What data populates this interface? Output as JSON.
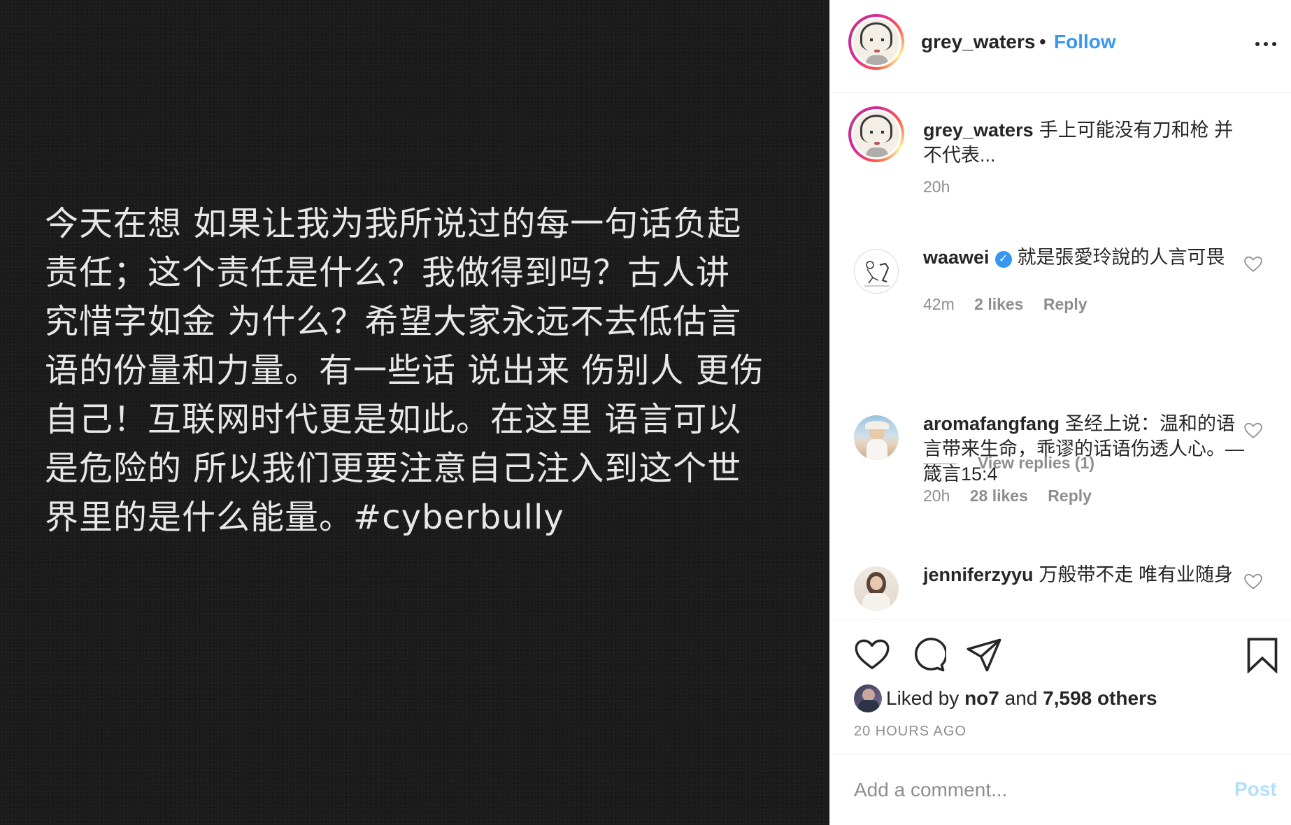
{
  "post": {
    "image_text": "今天在想 如果让我为我所说过的每一句话负起\n责任；这个责任是什么？我做得到吗？古人讲\n究惜字如金 为什么？希望大家永远不去低估言\n语的份量和力量。有一些话 说出来 伤别人 更伤\n自己！互联网时代更是如此。在这里 语言可以\n是危险的 所以我们更要注意自己注入到这个世\n界里的是什么能量。#cyberbully"
  },
  "header": {
    "username": "grey_waters",
    "separator": "•",
    "follow_label": "Follow"
  },
  "caption": {
    "username": "grey_waters",
    "text": "手上可能没有刀和枪 并不代表...",
    "time": "20h"
  },
  "comments": [
    {
      "username": "waawei",
      "verified": true,
      "text": "就是張愛玲說的人言可畏",
      "time": "42m",
      "likes": "2 likes",
      "reply_label": "Reply",
      "view_replies": "View replies (1)"
    },
    {
      "username": "aromafangfang",
      "text": "圣经上说：温和的语言带来生命，乖谬的话语伤透人心。—箴言15:4",
      "time": "20h",
      "likes": "28 likes",
      "reply_label": "Reply"
    },
    {
      "username": "jenniferzyyu",
      "text": "万般带不走 唯有业随身"
    }
  ],
  "actions": {
    "liked_prefix": "Liked by",
    "liked_user": "no7",
    "liked_and": "and",
    "liked_others": "7,598 others",
    "time_ago": "20 HOURS AGO"
  },
  "add_comment": {
    "placeholder": "Add a comment...",
    "post_label": "Post"
  },
  "colors": {
    "link_blue": "#3897f0",
    "post_disabled": "#b2dffc",
    "muted": "#8e8e8e",
    "image_bg": "#1b1b1b"
  }
}
